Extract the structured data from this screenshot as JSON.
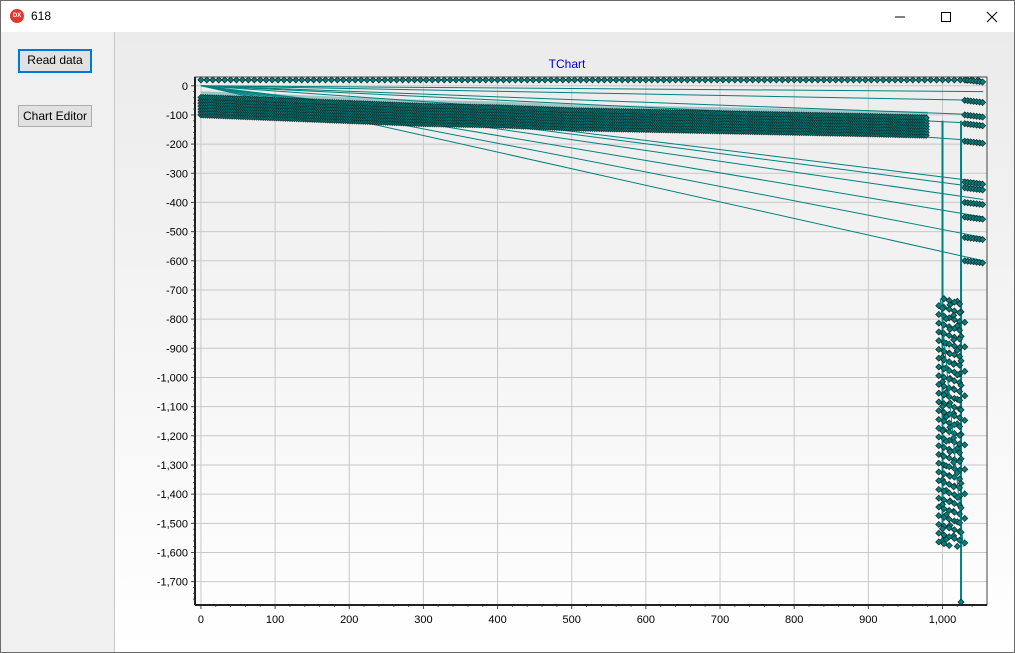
{
  "window": {
    "title": "618",
    "icon": "dx-app-icon",
    "controls": [
      "minimize-icon",
      "maximize-icon",
      "close-icon"
    ]
  },
  "sidebar": {
    "read_button_label": "Read data",
    "editor_button_label": "Chart Editor"
  },
  "colors": {
    "series": "#008080",
    "title": "#0000cc",
    "accent": "#0078d7"
  },
  "chart_data": {
    "type": "line",
    "title": "TChart",
    "xlabel": "",
    "ylabel": "",
    "xlim": [
      -8,
      1060
    ],
    "ylim": [
      -1780,
      30
    ],
    "grid": true,
    "legend": "none",
    "xticks": [
      0,
      100,
      200,
      300,
      400,
      500,
      600,
      700,
      800,
      900,
      1000
    ],
    "xtick_labels": [
      "0",
      "100",
      "200",
      "300",
      "400",
      "500",
      "600",
      "700",
      "800",
      "900",
      "1,000"
    ],
    "yticks": [
      0,
      -100,
      -200,
      -300,
      -400,
      -500,
      -600,
      -700,
      -800,
      -900,
      -1000,
      -1100,
      -1200,
      -1300,
      -1400,
      -1500,
      -1600,
      -1700
    ],
    "ytick_labels": [
      "0",
      "-100",
      "-200",
      "-300",
      "-400",
      "-500",
      "-600",
      "-700",
      "-800",
      "-900",
      "-1,000",
      "-1,100",
      "-1,200",
      "-1,300",
      "-1,400",
      "-1,500",
      "-1,600",
      "-1,700"
    ],
    "series": [
      {
        "top_line": [
          [
            0,
            20
          ],
          [
            1055,
            20
          ]
        ],
        "main_band": [
          [
            0,
            -60
          ],
          [
            100,
            -70
          ],
          [
            200,
            -80
          ],
          [
            300,
            -90
          ],
          [
            400,
            -95
          ],
          [
            450,
            -100
          ],
          [
            500,
            -105
          ],
          [
            600,
            -110
          ],
          [
            700,
            -115
          ],
          [
            800,
            -120
          ],
          [
            900,
            -125
          ],
          [
            980,
            -130
          ]
        ],
        "fan_lines": [
          [
            [
              0,
              0
            ],
            [
              1055,
              -20
            ]
          ],
          [
            [
              0,
              0
            ],
            [
              1055,
              -50
            ]
          ],
          [
            [
              0,
              0
            ],
            [
              1055,
              -100
            ]
          ],
          [
            [
              0,
              0
            ],
            [
              1055,
              -130
            ]
          ],
          [
            [
              0,
              0
            ],
            [
              1055,
              -190
            ]
          ],
          [
            [
              0,
              0
            ],
            [
              1055,
              -330
            ]
          ],
          [
            [
              0,
              0
            ],
            [
              1055,
              -350
            ]
          ],
          [
            [
              0,
              0
            ],
            [
              1055,
              -390
            ]
          ],
          [
            [
              0,
              0
            ],
            [
              1055,
              -450
            ]
          ],
          [
            [
              0,
              0
            ],
            [
              1055,
              -520
            ]
          ],
          [
            [
              0,
              0
            ],
            [
              1055,
              -600
            ]
          ]
        ],
        "right_clusters": [
          {
            "x": [
              1030,
              1055
            ],
            "y": 20
          },
          {
            "x": [
              1030,
              1055
            ],
            "y": -50
          },
          {
            "x": [
              1030,
              1055
            ],
            "y": -100
          },
          {
            "x": [
              1030,
              1055
            ],
            "y": -130
          },
          {
            "x": [
              1030,
              1055
            ],
            "y": -190
          },
          {
            "x": [
              1030,
              1055
            ],
            "y": -330
          },
          {
            "x": [
              1030,
              1055
            ],
            "y": -350
          },
          {
            "x": [
              1030,
              1055
            ],
            "y": -400
          },
          {
            "x": [
              1030,
              1055
            ],
            "y": -450
          },
          {
            "x": [
              1030,
              1055
            ],
            "y": -520
          },
          {
            "x": [
              1030,
              1055
            ],
            "y": -600
          }
        ],
        "vertical_drop_1": {
          "x": 1000,
          "y_from": -120,
          "y_to": -1560
        },
        "vertical_drop_2": {
          "x": 1025,
          "y_from": -120,
          "y_to": -1770
        },
        "lower_cluster": {
          "x": [
            995,
            1030
          ],
          "y": [
            -730,
            -1580
          ]
        }
      }
    ]
  }
}
